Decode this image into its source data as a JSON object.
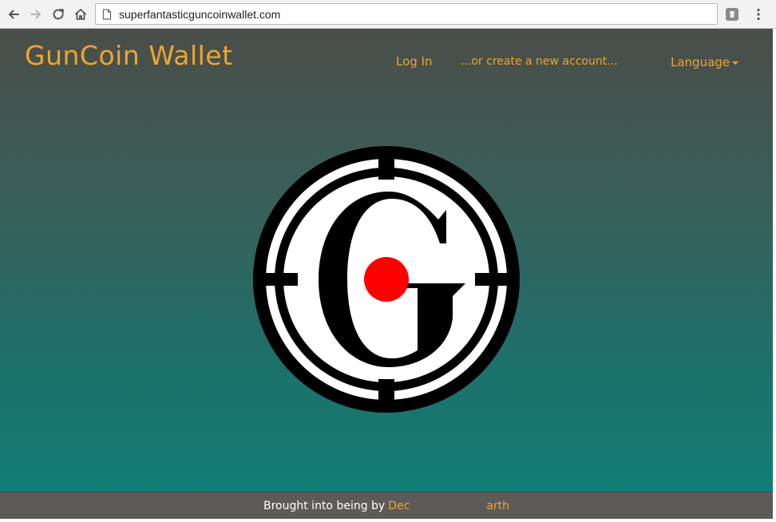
{
  "browser": {
    "url": "superfantasticguncoinwallet.com",
    "icons": {
      "back": "arrow-left-icon",
      "forward": "arrow-right-icon",
      "reload": "reload-icon",
      "home": "home-icon",
      "page": "page-icon",
      "extension": "extension-icon",
      "menu": "kebab-menu-icon"
    }
  },
  "header": {
    "brand": "GunCoin Wallet",
    "nav": {
      "login": "Log In",
      "create_account": "...or create a new account...",
      "language": "Language"
    }
  },
  "logo": {
    "description_icon": "crosshair-g-logo",
    "colors": {
      "ring": "#000000",
      "dot": "#ff0000",
      "gap": "#ffffff"
    }
  },
  "footer": {
    "prefix": "Brought into being by",
    "author_start": "Dec",
    "author_end": "arth"
  },
  "colors": {
    "accent": "#eda52d",
    "header_top": "#4b4d49",
    "page_bottom": "#107e76",
    "footer_bg": "#5d5b58"
  }
}
